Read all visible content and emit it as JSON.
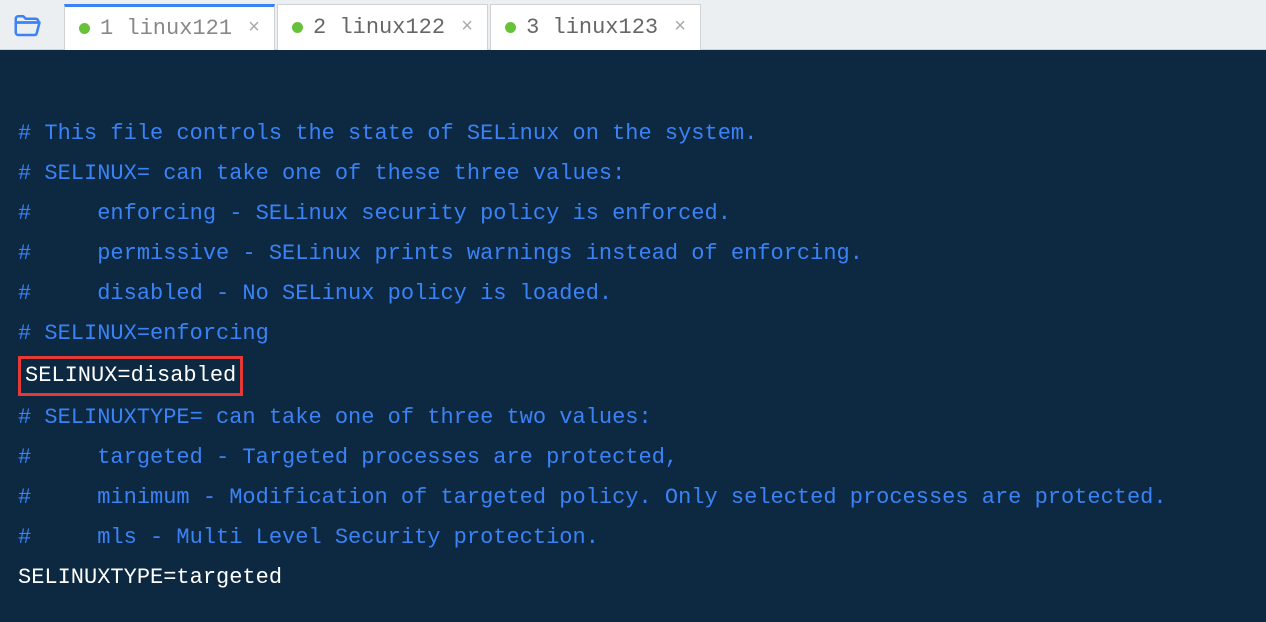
{
  "tabs": [
    {
      "label": "1 linux121",
      "close": "×",
      "active": true
    },
    {
      "label": "2 linux122",
      "close": "×",
      "active": false
    },
    {
      "label": "3 linux123",
      "close": "×",
      "active": false
    }
  ],
  "editor": {
    "lines": [
      {
        "type": "empty"
      },
      {
        "type": "comment",
        "text": "# This file controls the state of SELinux on the system."
      },
      {
        "type": "comment",
        "text": "# SELINUX= can take one of these three values:"
      },
      {
        "type": "comment",
        "text": "#     enforcing - SELinux security policy is enforced."
      },
      {
        "type": "comment",
        "text": "#     permissive - SELinux prints warnings instead of enforcing."
      },
      {
        "type": "comment",
        "text": "#     disabled - No SELinux policy is loaded."
      },
      {
        "type": "comment",
        "text": "# SELINUX=enforcing"
      },
      {
        "type": "highlighted",
        "text": "SELINUX=disabled"
      },
      {
        "type": "comment",
        "text": "# SELINUXTYPE= can take one of three two values:"
      },
      {
        "type": "comment",
        "text": "#     targeted - Targeted processes are protected,"
      },
      {
        "type": "comment",
        "text": "#     minimum - Modification of targeted policy. Only selected processes are protected."
      },
      {
        "type": "comment",
        "text": "#     mls - Multi Level Security protection."
      },
      {
        "type": "plain",
        "text": "SELINUXTYPE=targeted"
      }
    ]
  }
}
